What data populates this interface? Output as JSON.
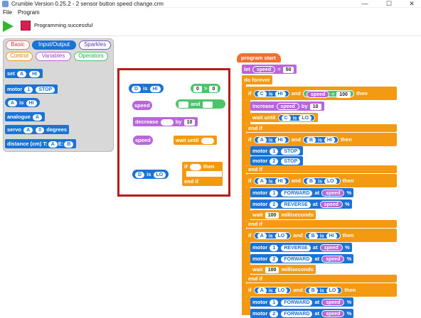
{
  "window": {
    "title": "Crumble Version 0.25.2 - 2 sensor button speed change.crm",
    "minimize": "—",
    "maximize": "☐",
    "close": "✕"
  },
  "menu": {
    "file": "File",
    "program": "Program"
  },
  "toolbar": {
    "status": "Programming successful"
  },
  "palette": {
    "categories": [
      "Basic",
      "Input/Output",
      "Sparkles",
      "Control",
      "Variables",
      "Operators"
    ],
    "blocks": {
      "set": "set",
      "set_pin": "A",
      "set_val": "HI",
      "motor": "motor",
      "motor_num": "1",
      "motor_state": "STOP",
      "pin": "A",
      "is": "is",
      "pin_val": "HI",
      "analogue": "analogue",
      "analogue_pin": "A",
      "servo": "servo",
      "servo_pin": "A",
      "servo_deg": "0",
      "degrees": "degrees",
      "distance": "distance (cm)",
      "trig": "T:",
      "trig_pin": "A",
      "echo": "E:",
      "echo_pin": "B"
    }
  },
  "floating": {
    "d_is_hi": {
      "pin": "D",
      "is": "is",
      "val": "HI"
    },
    "compare": {
      "a": "0",
      "op": ">",
      "b": "0"
    },
    "speed1": "speed",
    "and": "and",
    "decrease": "decrease",
    "by": "by",
    "dec_val": "10",
    "speed2": "speed",
    "wait_until": "wait until",
    "d_is_lo": {
      "pin": "D",
      "is": "is",
      "val": "LO"
    },
    "if": "if",
    "then": "then",
    "end_if": "end if"
  },
  "program": {
    "start": "program start",
    "let": "let",
    "let_var": "speed",
    "eq": "=",
    "let_val": "50",
    "do_forever": "do forever",
    "if": "if",
    "then": "then",
    "and": "and",
    "is": "is",
    "end_if": "end if",
    "b1": {
      "p1": "C",
      "v1": "HI",
      "var": "speed",
      "op": "<",
      "num": "100"
    },
    "increase": "increase",
    "inc_var": "speed",
    "by": "by",
    "inc_val": "10",
    "wait_until": "wait until",
    "wu_pin": "C",
    "wu_val": "LO",
    "b2": {
      "p1": "A",
      "v1": "HI",
      "p2": "B",
      "v2": "HI"
    },
    "motor": "motor",
    "stop": "STOP",
    "forward": "FORWARD",
    "reverse": "REVERSE",
    "at": "at",
    "pct": "%",
    "speed": "speed",
    "m1": "1",
    "m2": "2",
    "b3": {
      "p1": "A",
      "v1": "HI",
      "p2": "B",
      "v2": "LO"
    },
    "wait": "wait",
    "ms_val": "100",
    "ms": "milliseconds",
    "b4": {
      "p1": "A",
      "v1": "LO",
      "p2": "B",
      "v2": "HI"
    },
    "b5": {
      "p1": "A",
      "v1": "LO",
      "p2": "B",
      "v2": "LO"
    }
  },
  "colors": {
    "control": "#f39a12",
    "io": "#1b73d6",
    "variables": "#b866d9",
    "operators": "#4cc46b",
    "stop": "#d4204f",
    "play": "#33b533",
    "highlight": "#b71c1c"
  }
}
